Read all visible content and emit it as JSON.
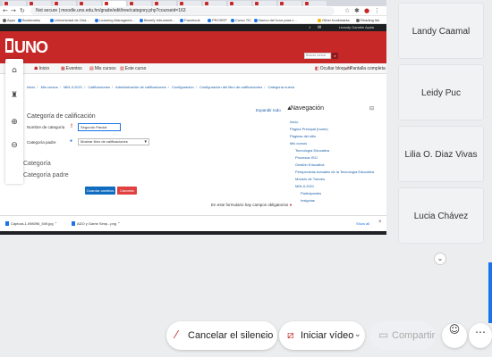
{
  "browser": {
    "address": "Not secure | moodle.uno.edu.hn/grade/edit/tree/category.php?courseid=163",
    "bookmarks": [
      "Apps",
      "Bookmarks",
      "Universidad de Oria...",
      "Learning Manageme...",
      "Benefy Intrumenti...",
      "Facebook",
      "PROSEP",
      "Curso TIC",
      "Nuevo del hour para c..."
    ],
    "other_bookmarks": "Other bookmarks",
    "reading_list": "Reading list"
  },
  "moodle": {
    "logo": "UNO",
    "user_name": "Leandy Gamble Ayala",
    "search_placeholder": "Buscar cursos",
    "nav": [
      {
        "icon": "☗",
        "label": "Inicio"
      },
      {
        "icon": "▦",
        "label": "Eventos"
      },
      {
        "icon": "▤",
        "label": "Mis cursos"
      },
      {
        "icon": "▥",
        "label": "Este curso"
      }
    ],
    "ocultar_bloques": "Ocultar bloques",
    "pantalla_completa": "Pantalla completa",
    "breadcrumb": [
      "Inicio",
      "Mis cursos",
      "MIN-II-2021",
      "Calificaciones",
      "Administración de calificaciones",
      "Configuración",
      "Configuración del libro de calificaciones",
      "Categoría nueva"
    ],
    "form": {
      "title": "Categoría de calificación",
      "name_label": "Nombre de categoría",
      "name_value": "Segundo Parcial",
      "parent_label": "Categoría padre",
      "parent_value": "Mostrar libro de calificaciones",
      "section_category": "Categoría",
      "section_parent": "Categoría padre",
      "expand_all": "Expandir todo",
      "save_label": "Guardar cambios",
      "cancel_label": "Cancelar",
      "required_note": "En este formulario hay campos obligatorios"
    },
    "navigation": {
      "title": "Navegación",
      "items": [
        "Inicio",
        "Página Principal (home)",
        "Páginas del sitio",
        "Mis cursos",
        "Tecnología Educativa",
        "Procesos ISO",
        "Gestión Educativa",
        "Perspectivas Actuales de la Tecnología Educativa",
        "Módulo de Tutores",
        "MIN-II-2021",
        "Participantes",
        "Insignias"
      ]
    }
  },
  "downloads": [
    {
      "name": "Captura-1.098096_549.jpg"
    },
    {
      "name": "ADO y Game Simp...png"
    }
  ],
  "downloads_show_all": "Show all",
  "participants": [
    "Landy Caamal",
    "Leidy Puc",
    "Lilia O. Diaz Vivas",
    "Lucia Chávez"
  ],
  "controls": {
    "unmute": "Cancelar el silencio",
    "start_video": "Iniciar vídeo",
    "share": "Compartir"
  },
  "colors": {
    "brand_red": "#c62828",
    "moodle_dark": "#1d1f21",
    "save_blue": "#0f6cbf",
    "cancel_red": "#e04040"
  }
}
